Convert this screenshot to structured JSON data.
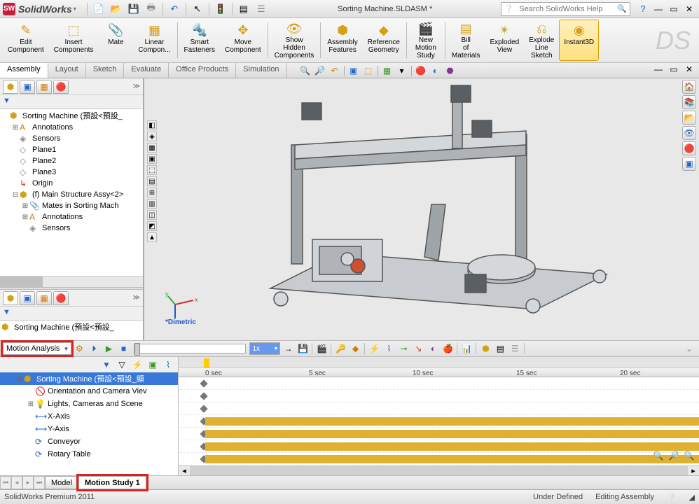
{
  "app": {
    "name": "SolidWorks",
    "title_arrow": "▾"
  },
  "document": {
    "title": "Sorting Machine.SLDASM *"
  },
  "search": {
    "placeholder": "Search SolidWorks Help"
  },
  "ribbon": {
    "items": [
      {
        "label": "Edit Component",
        "icon": "✎"
      },
      {
        "label": "Insert Components",
        "icon": "⬚"
      },
      {
        "label": "Mate",
        "icon": "📎"
      },
      {
        "label": "Linear Compon...",
        "icon": "▦"
      },
      {
        "label": "Smart Fasteners",
        "icon": "🔩"
      },
      {
        "label": "Move Component",
        "icon": "✥"
      },
      {
        "label": "Show Hidden Components",
        "icon": "👁"
      },
      {
        "label": "Assembly Features",
        "icon": "⬢"
      },
      {
        "label": "Reference Geometry",
        "icon": "◆"
      },
      {
        "label": "New Motion Study",
        "icon": "🎬"
      },
      {
        "label": "Bill of Materials",
        "icon": "▤"
      },
      {
        "label": "Exploded View",
        "icon": "✴"
      },
      {
        "label": "Explode Line Sketch",
        "icon": "⎌"
      },
      {
        "label": "Instant3D",
        "icon": "◉"
      }
    ]
  },
  "command_tabs": [
    "Assembly",
    "Layout",
    "Sketch",
    "Evaluate",
    "Office Products",
    "Simulation"
  ],
  "feature_tree": {
    "filter_icon": "▼",
    "top": [
      {
        "ind": 0,
        "exp": "",
        "icon": "⬢",
        "label": "Sorting Machine (預設<預設_",
        "cls": "c-yellow"
      },
      {
        "ind": 1,
        "exp": "⊞",
        "icon": "A",
        "label": "Annotations",
        "cls": "c-orange"
      },
      {
        "ind": 1,
        "exp": "",
        "icon": "◈",
        "label": "Sensors",
        "cls": "c-gray"
      },
      {
        "ind": 1,
        "exp": "",
        "icon": "◇",
        "label": "Plane1",
        "cls": "c-gray"
      },
      {
        "ind": 1,
        "exp": "",
        "icon": "◇",
        "label": "Plane2",
        "cls": "c-gray"
      },
      {
        "ind": 1,
        "exp": "",
        "icon": "◇",
        "label": "Plane3",
        "cls": "c-gray"
      },
      {
        "ind": 1,
        "exp": "",
        "icon": "↳",
        "label": "Origin",
        "cls": "c-red"
      },
      {
        "ind": 1,
        "exp": "⊟",
        "icon": "⬢",
        "label": "(f) Main Structure Assy<2>",
        "cls": "c-yellow"
      },
      {
        "ind": 2,
        "exp": "⊞",
        "icon": "📎",
        "label": "Mates in Sorting Mach",
        "cls": "c-gray"
      },
      {
        "ind": 2,
        "exp": "⊞",
        "icon": "A",
        "label": "Annotations",
        "cls": "c-orange"
      },
      {
        "ind": 2,
        "exp": "",
        "icon": "◈",
        "label": "Sensors",
        "cls": "c-gray"
      }
    ],
    "bottom_root": "Sorting Machine (預設<預設_"
  },
  "viewport": {
    "orientation": "*Dimetric",
    "axes": [
      "x",
      "y",
      "z"
    ]
  },
  "motion": {
    "type_dropdown": "Motion Analysis",
    "speed": "1x",
    "tree": [
      {
        "ind": 0,
        "exp": "⊟",
        "icon": "⬢",
        "label": "Sorting Machine (預設<預設_顯",
        "sel": true,
        "cls": "c-yellow"
      },
      {
        "ind": 1,
        "exp": "",
        "icon": "🚫",
        "label": "Orientation and Camera Viev",
        "cls": "c-red"
      },
      {
        "ind": 1,
        "exp": "⊞",
        "icon": "💡",
        "label": "Lights, Cameras and Scene",
        "cls": "c-orange"
      },
      {
        "ind": 1,
        "exp": "",
        "icon": "⟷",
        "label": "X-Axis",
        "cls": "c-blue"
      },
      {
        "ind": 1,
        "exp": "",
        "icon": "⟷",
        "label": "Y-Axis",
        "cls": "c-blue"
      },
      {
        "ind": 1,
        "exp": "",
        "icon": "⟳",
        "label": "Conveyor",
        "cls": "c-blue"
      },
      {
        "ind": 1,
        "exp": "",
        "icon": "⟳",
        "label": "Rotary Table",
        "cls": "c-blue"
      }
    ],
    "timeline": {
      "ticks": [
        {
          "label": "0 sec",
          "pos": 38
        },
        {
          "label": "5 sec",
          "pos": 186
        },
        {
          "label": "10 sec",
          "pos": 334
        },
        {
          "label": "15 sec",
          "pos": 482
        },
        {
          "label": "20 sec",
          "pos": 630
        }
      ]
    }
  },
  "bottom_tabs": {
    "model": "Model",
    "motion_study": "Motion Study 1"
  },
  "status": {
    "left": "SolidWorks Premium 2011",
    "underdef": "Under Defined",
    "mode": "Editing Assembly"
  }
}
